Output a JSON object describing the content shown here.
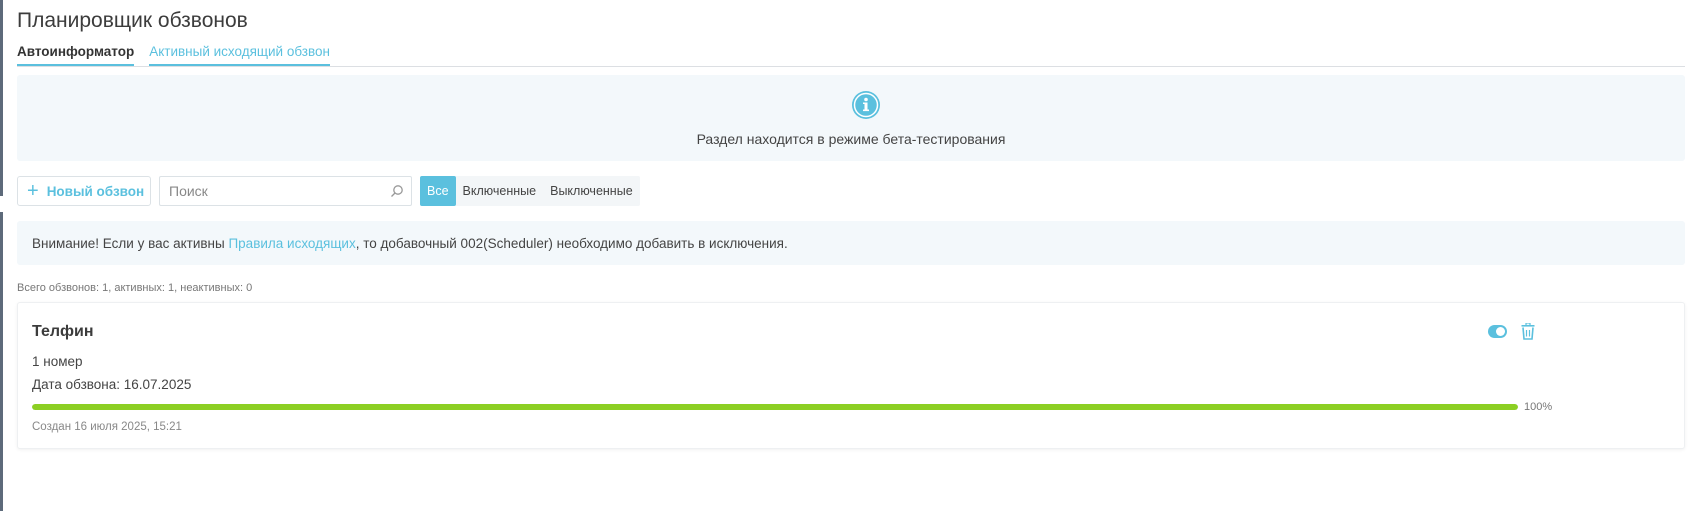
{
  "page": {
    "title": "Планировщик обзвонов"
  },
  "tabs": [
    {
      "label": "Автоинформатор",
      "active": true
    },
    {
      "label": "Активный исходящий обзвон",
      "active": false
    }
  ],
  "beta_notice": {
    "icon": "info-icon",
    "text": "Раздел находится в режиме бета-тестирования"
  },
  "toolbar": {
    "new_button_label": "Новый обзвон",
    "search_placeholder": "Поиск",
    "search_value": "",
    "filters": [
      "Все",
      "Включенные",
      "Выключенные"
    ],
    "active_filter": "Все"
  },
  "warning": {
    "prefix": "Внимание! Если у вас активны ",
    "link": "Правила исходящих",
    "suffix": ", то добавочный 002(Scheduler) необходимо добавить в исключения."
  },
  "summary": "Всего обзвонов: 1, активных: 1, неактивных: 0",
  "campaign": {
    "title": "Телфин",
    "numbers": "1 номер",
    "date": "Дата обзвона: 16.07.2025",
    "progress": 100,
    "progress_label": "100%",
    "created": "Создан 16 июля 2025, 15:21",
    "enabled": true
  },
  "colors": {
    "accent": "#5bc0de",
    "progress": "#8ccf23",
    "notice_bg": "#f3f8fb"
  }
}
